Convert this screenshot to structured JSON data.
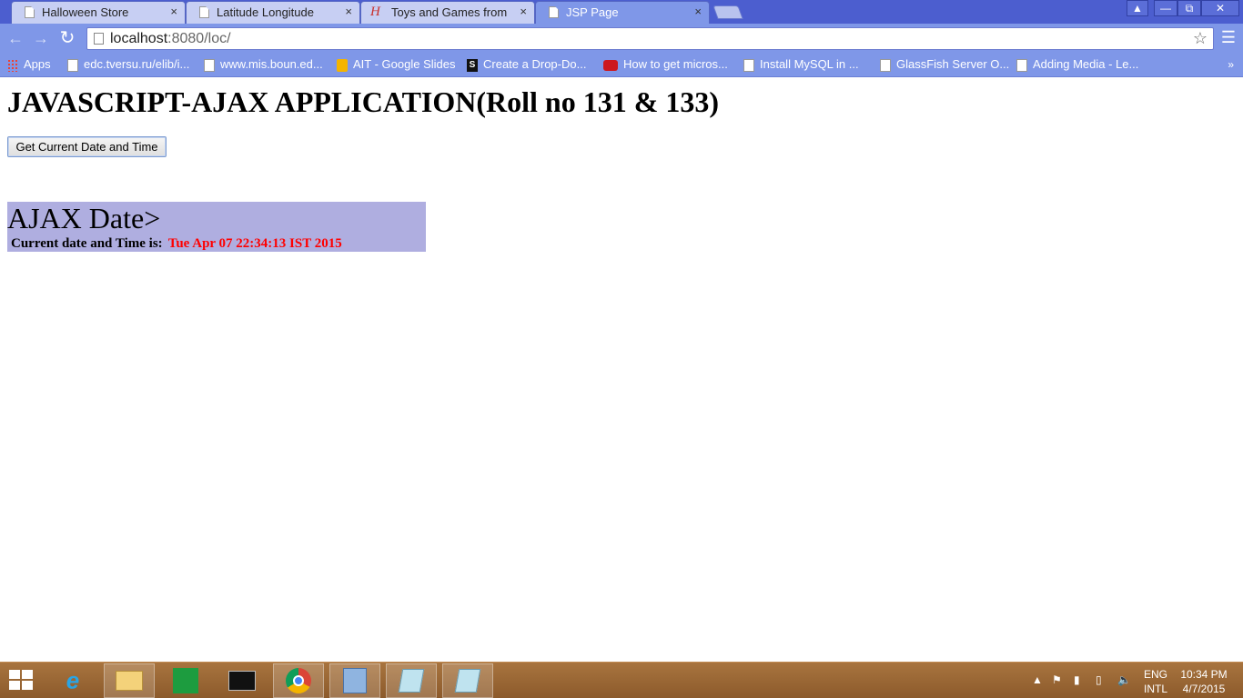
{
  "browser": {
    "tabs": [
      {
        "title": "Halloween Store",
        "icon": "page-icon"
      },
      {
        "title": "Latitude Longitude",
        "icon": "page-icon"
      },
      {
        "title": "Toys and Games from H",
        "icon": "h-brand-icon"
      },
      {
        "title": "JSP Page",
        "icon": "page-icon",
        "active": true
      }
    ],
    "tab_close": "×",
    "url_host": "localhost",
    "url_rest": ":8080/loc/",
    "bookmarks": [
      {
        "label": "Apps",
        "icon": "apps-grid-icon"
      },
      {
        "label": "edc.tversu.ru/elib/i...",
        "icon": "page-icon"
      },
      {
        "label": "www.mis.boun.ed...",
        "icon": "page-icon"
      },
      {
        "label": "AIT - Google Slides",
        "icon": "slides-icon"
      },
      {
        "label": "Create a Drop-Do...",
        "icon": "s-icon"
      },
      {
        "label": "How to get micros...",
        "icon": "youtube-icon"
      },
      {
        "label": "Install MySQL in ...",
        "icon": "page-icon"
      },
      {
        "label": "GlassFish Server O...",
        "icon": "page-icon"
      },
      {
        "label": "Adding Media - Le...",
        "icon": "page-icon"
      }
    ],
    "bookmarks_more": "»"
  },
  "page": {
    "title": "JAVASCRIPT-AJAX APPLICATION(Roll no 131 & 133)",
    "button_label": "Get Current Date and Time",
    "result_heading": "AJAX Date>",
    "result_label": "Current date and Time is:",
    "result_value": "Tue Apr 07 22:34:13 IST 2015"
  },
  "taskbar": {
    "apps": [
      "internet-explorer-icon",
      "file-explorer-icon",
      "store-icon",
      "cmd-icon",
      "chrome-icon",
      "virtualbox-icon",
      "notepad-icon",
      "notepad-icon"
    ],
    "lang_top": "ENG",
    "lang_bottom": "INTL",
    "time": "10:34 PM",
    "date": "4/7/2015"
  },
  "colors": {
    "tabstrip": "#4c5ecf",
    "toolbar": "#7f97e8",
    "result_box": "#afaee0",
    "result_value": "#ff0000",
    "taskbar": "#9b6835"
  }
}
